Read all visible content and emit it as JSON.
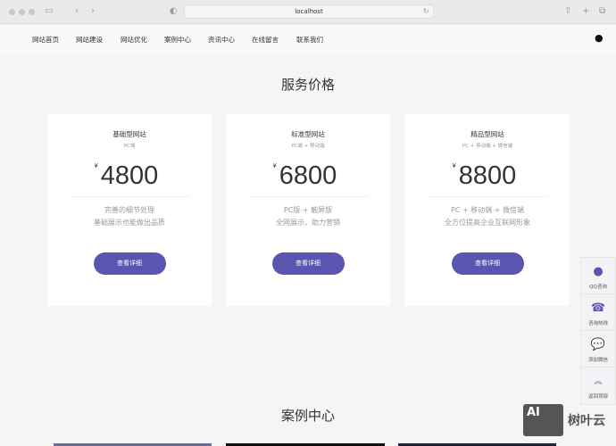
{
  "browser": {
    "url": "localhost"
  },
  "nav": [
    "网站首页",
    "网站建设",
    "网站优化",
    "案例中心",
    "资讯中心",
    "在线留言",
    "联系我们"
  ],
  "pricing": {
    "title": "服务价格",
    "currency": "¥",
    "button": "查看详细",
    "cards": [
      {
        "title": "基础型网站",
        "sub": "PC端",
        "price": "4800",
        "desc1": "完善的细节处理",
        "desc2": "基础展示也能做出品质"
      },
      {
        "title": "标准型网站",
        "sub": "PC端 + 移动端",
        "price": "6800",
        "desc1": "PC版 + 触屏版",
        "desc2": "全网展示，助力营销"
      },
      {
        "title": "精品型网站",
        "sub": "PC + 移动端 + 微信端",
        "price": "8800",
        "desc1": "PC + 移动端 + 微信端",
        "desc2": "全方位提高企业互联网形象"
      }
    ]
  },
  "cases": {
    "title": "案例中心"
  },
  "side": [
    "QQ咨询",
    "咨询热线",
    "添加微信",
    "返回顶部"
  ],
  "watermark": {
    "logo": "AI",
    "text": "树叶云"
  },
  "colors": {
    "accent": "#5a56b0"
  }
}
